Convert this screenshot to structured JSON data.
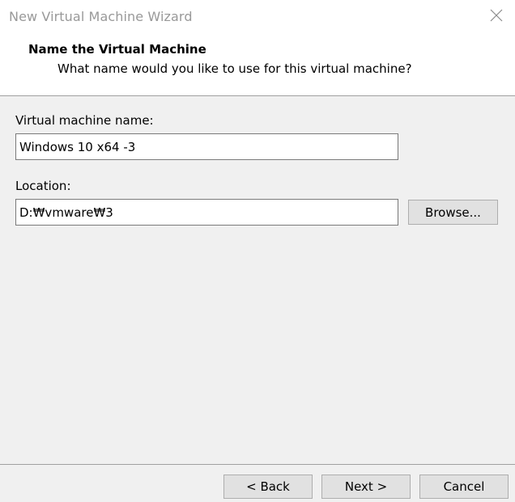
{
  "window": {
    "title": "New Virtual Machine Wizard",
    "close_icon": "close-icon"
  },
  "header": {
    "title": "Name the Virtual Machine",
    "subtitle": "What name would you like to use for this virtual machine?"
  },
  "form": {
    "vm_name_label": "Virtual machine name:",
    "vm_name_value": "Windows 10 x64 -3",
    "location_label": "Location:",
    "location_value": "D:₩vmware₩3",
    "browse_label": "Browse..."
  },
  "footer": {
    "back_label": "< Back",
    "next_label": "Next >",
    "cancel_label": "Cancel"
  }
}
